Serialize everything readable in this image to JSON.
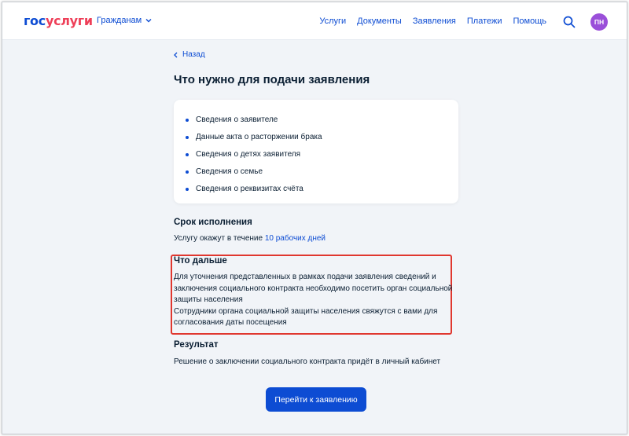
{
  "header": {
    "logo_part1": "гос",
    "logo_part2": "услуги",
    "citizens_menu": "Гражданам",
    "nav": [
      "Услуги",
      "Документы",
      "Заявления",
      "Платежи",
      "Помощь"
    ],
    "avatar_initials": "ПН"
  },
  "back_label": "Назад",
  "page_title": "Что нужно для подачи заявления",
  "requirements": [
    "Сведения о заявителе",
    "Данные акта о расторжении брака",
    "Сведения о детях заявителя",
    "Сведения о семье",
    "Сведения о реквизитах счёта"
  ],
  "deadline": {
    "heading": "Срок исполнения",
    "text": "Услугу окажут в течение",
    "days": "10 рабочих дней"
  },
  "next_steps": {
    "heading": "Что дальше",
    "lines": [
      "Для уточнения представленных в рамках подачи заявления сведений и",
      "заключения социального контракта необходимо посетить орган социальной",
      "защиты населения",
      "Сотрудники органа социальной защиты населения свяжутся с вами для",
      "согласования даты посещения"
    ]
  },
  "result": {
    "heading": "Результат",
    "text": "Решение о заключении социального контракта придёт в личный кабинет"
  },
  "action_button": "Перейти к заявлению",
  "colors": {
    "accent": "#0d4cd3",
    "brand_red": "#ee3f58",
    "avatar": "#9a4fd9",
    "highlight_border": "#e0372f",
    "page_bg": "#f1f4f8"
  }
}
